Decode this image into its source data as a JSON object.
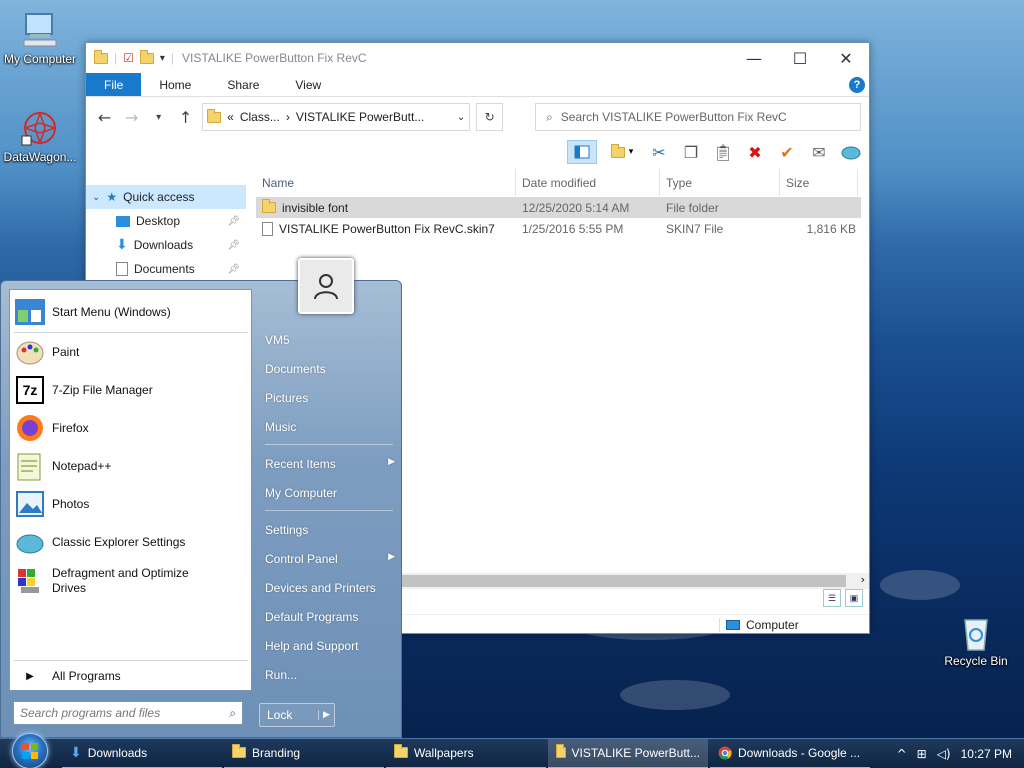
{
  "desktop": {
    "icons": [
      {
        "label": "My Computer"
      },
      {
        "label": "DataWagon..."
      },
      {
        "label": "Recycle Bin"
      }
    ]
  },
  "explorer": {
    "title": "VISTALIKE PowerButton Fix RevC",
    "controls": {
      "minimize": "—",
      "maximize": "☐",
      "close": "✕"
    },
    "ribbon": {
      "file": "File",
      "home": "Home",
      "share": "Share",
      "view": "View",
      "help": "?"
    },
    "address": {
      "prefix": "«",
      "crumb1": "Class...",
      "sep": "›",
      "crumb2": "VISTALIKE PowerButt..."
    },
    "search_placeholder": "Search VISTALIKE PowerButton Fix RevC",
    "nav": [
      {
        "label": "Quick access"
      },
      {
        "label": "Desktop"
      },
      {
        "label": "Downloads"
      },
      {
        "label": "Documents"
      }
    ],
    "columns": {
      "name": "Name",
      "date": "Date modified",
      "type": "Type",
      "size": "Size"
    },
    "files": [
      {
        "name": "invisible font",
        "date": "12/25/2020 5:14 AM",
        "type": "File folder",
        "size": ""
      },
      {
        "name": "VISTALIKE PowerButton Fix RevC.skin7",
        "date": "1/25/2016 5:55 PM",
        "type": "SKIN7 File",
        "size": "1,816 KB"
      }
    ],
    "status": {
      "location": "Computer"
    }
  },
  "startmenu": {
    "left": [
      {
        "label": "Start Menu (Windows)"
      },
      {
        "label": "Paint"
      },
      {
        "label": "7-Zip File Manager"
      },
      {
        "label": "Firefox"
      },
      {
        "label": "Notepad++"
      },
      {
        "label": "Photos"
      },
      {
        "label": "Classic Explorer Settings"
      },
      {
        "label": "Defragment and Optimize Drives"
      }
    ],
    "all_programs": "All Programs",
    "search_placeholder": "Search programs and files",
    "right": [
      {
        "label": "VM5"
      },
      {
        "label": "Documents"
      },
      {
        "label": "Pictures"
      },
      {
        "label": "Music"
      },
      {
        "label": "Recent Items"
      },
      {
        "label": "My Computer"
      },
      {
        "label": "Settings"
      },
      {
        "label": "Control Panel"
      },
      {
        "label": "Devices and Printers"
      },
      {
        "label": "Default Programs"
      },
      {
        "label": "Help and Support"
      },
      {
        "label": "Run..."
      }
    ],
    "lock": "Lock"
  },
  "taskbar": {
    "buttons": [
      {
        "label": "Downloads"
      },
      {
        "label": "Branding"
      },
      {
        "label": "Wallpapers"
      },
      {
        "label": "VISTALIKE PowerButt..."
      },
      {
        "label": "Downloads - Google ..."
      }
    ],
    "clock": "10:27 PM"
  }
}
